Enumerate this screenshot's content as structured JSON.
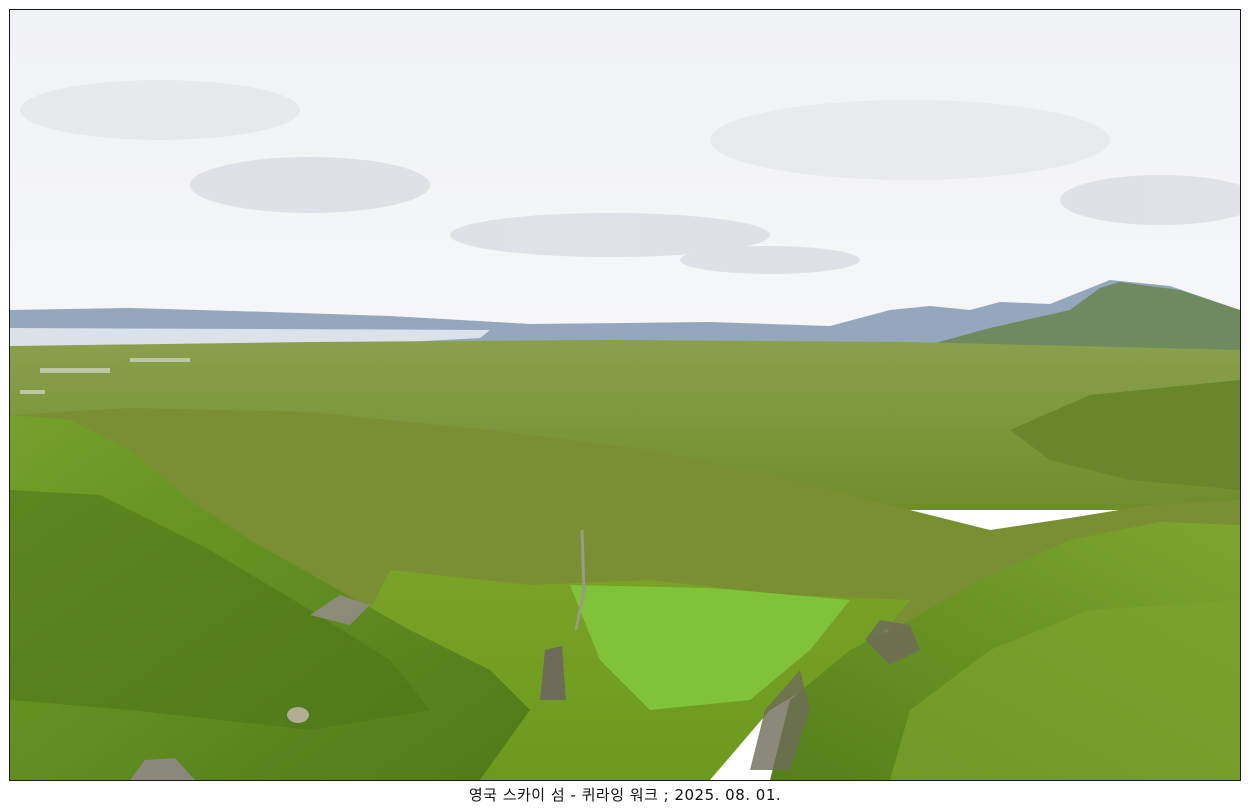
{
  "photo": {
    "subject": "Quiraing landscape photograph",
    "colors": {
      "sky_top": "#eef0f2",
      "sky_bottom": "#f4f5f6",
      "cloud": "#d8dce1",
      "sea": "#d9e2ea",
      "far_mountain": "#8ea3ba",
      "grass_far": "#7a9a3c",
      "grass_mid": "#6f8f2a",
      "grass_near": "#5f8a1c",
      "grass_bright": "#7cc030",
      "rock": "#6b6a55"
    }
  },
  "caption": {
    "text": "영국 스카이 섬 - 퀴라잉 워크 ; 2025. 08. 01."
  }
}
